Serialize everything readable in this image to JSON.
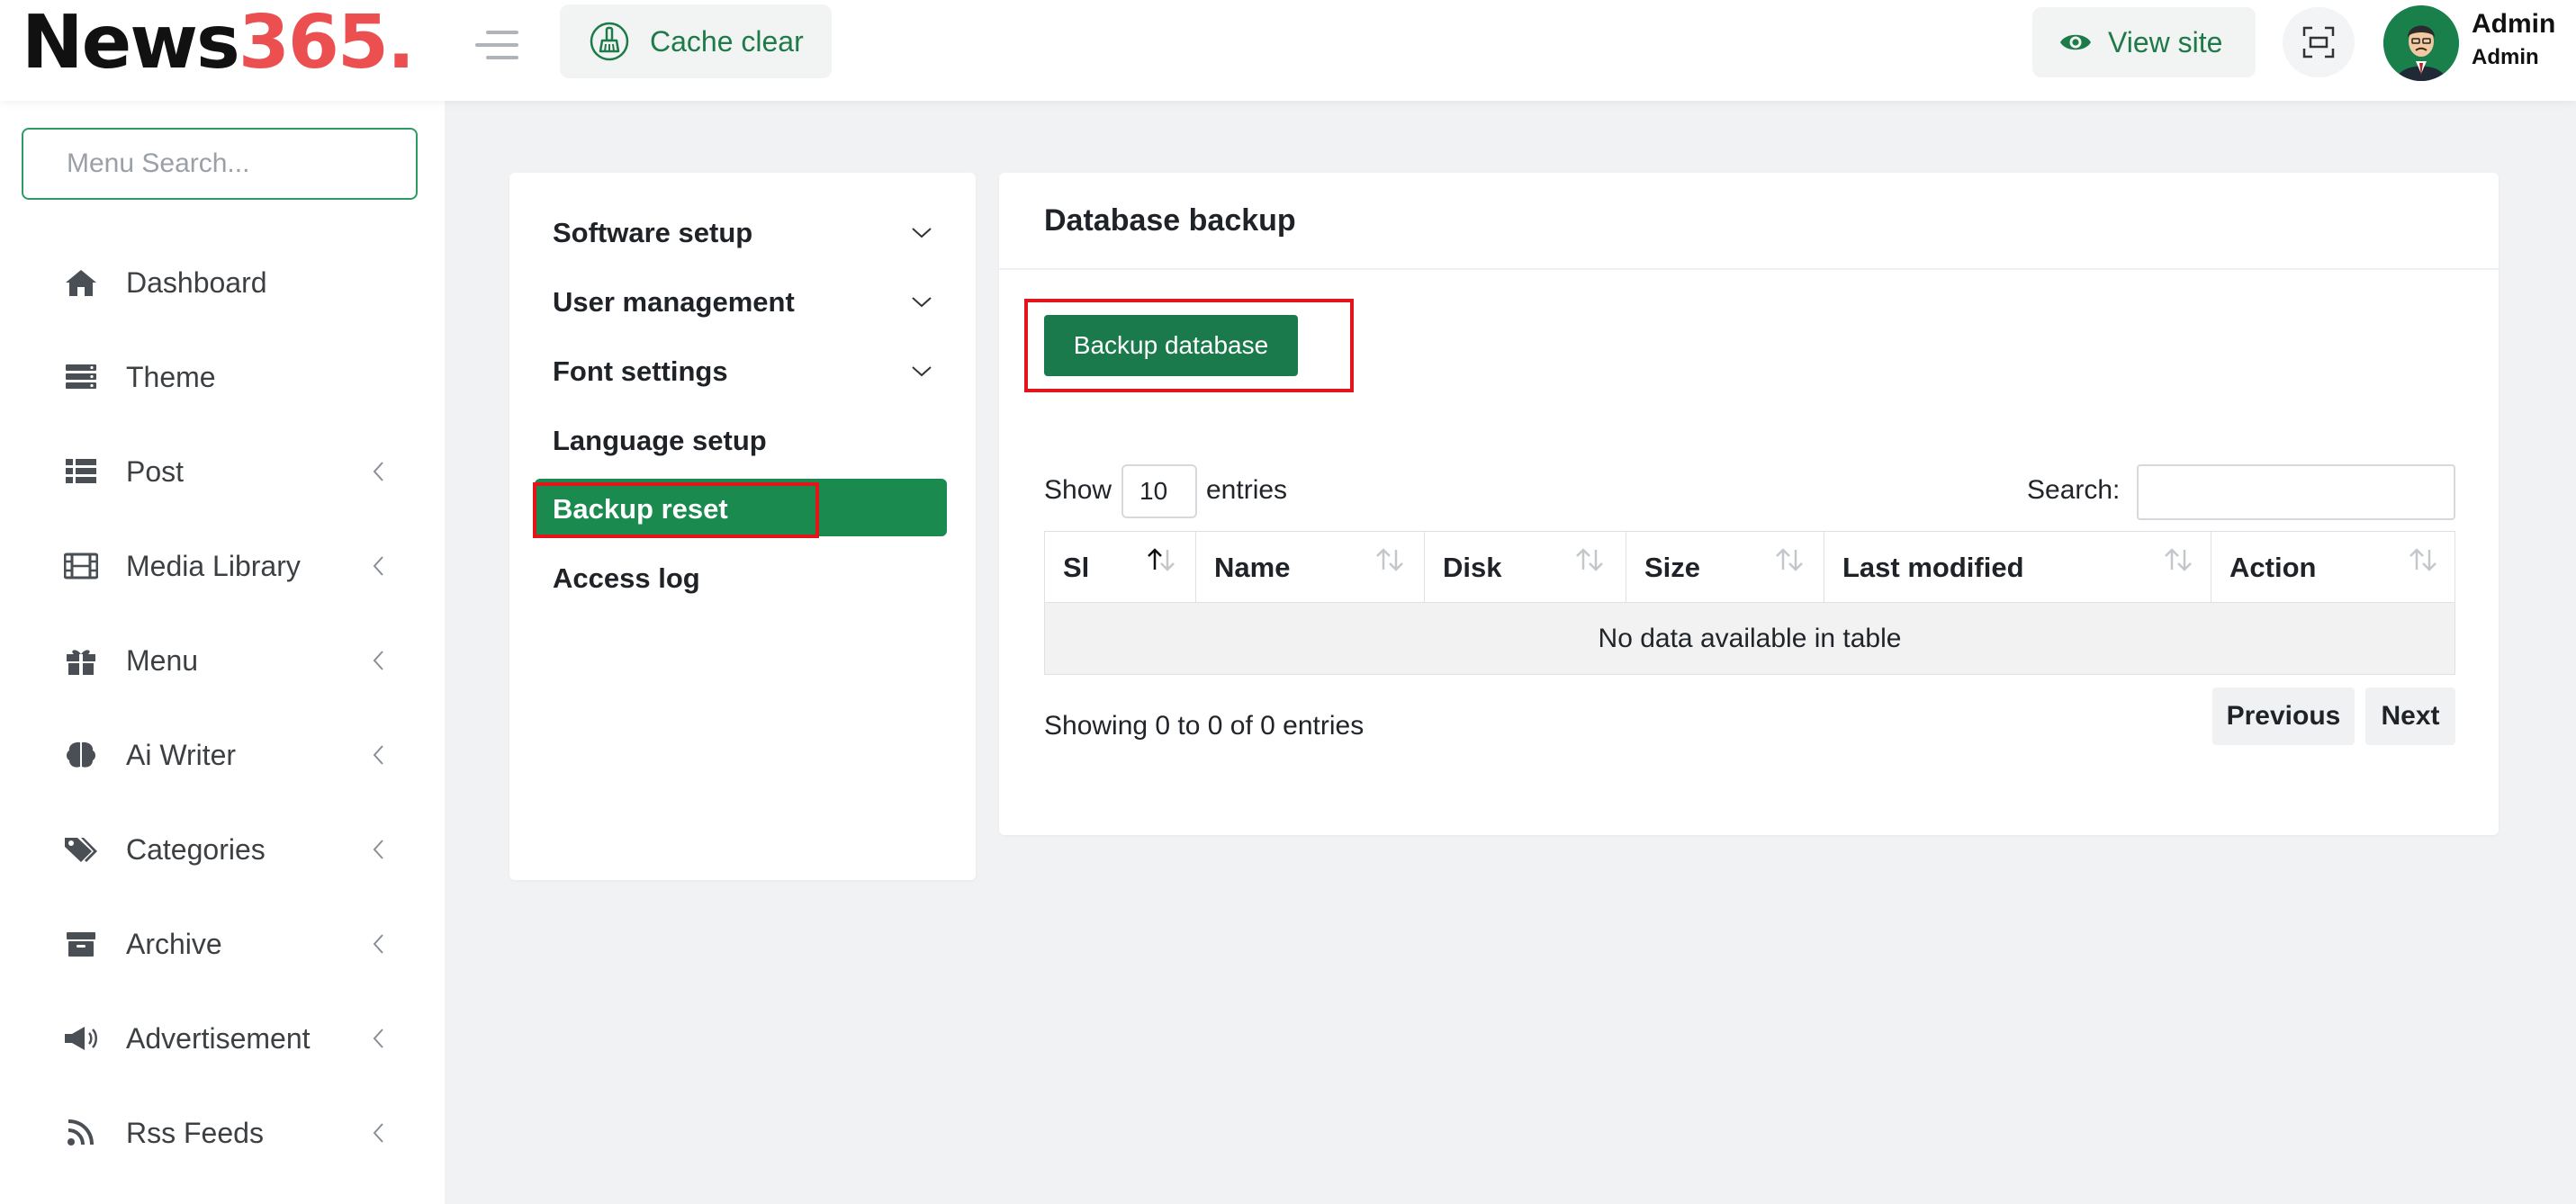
{
  "header": {
    "logo_part1": "News",
    "logo_part2": "365.",
    "cache_clear_label": "Cache clear",
    "view_site_label": "View site",
    "user_name": "Admin",
    "user_role": "Admin"
  },
  "sidebar": {
    "search_placeholder": "Menu Search...",
    "items": [
      {
        "label": "Dashboard",
        "icon": "home-icon",
        "has_chevron": false
      },
      {
        "label": "Theme",
        "icon": "layers-icon",
        "has_chevron": false
      },
      {
        "label": "Post",
        "icon": "list-icon",
        "has_chevron": true
      },
      {
        "label": "Media Library",
        "icon": "film-icon",
        "has_chevron": true
      },
      {
        "label": "Menu",
        "icon": "gift-icon",
        "has_chevron": true
      },
      {
        "label": "Ai Writer",
        "icon": "brain-icon",
        "has_chevron": true
      },
      {
        "label": "Categories",
        "icon": "tags-icon",
        "has_chevron": true
      },
      {
        "label": "Archive",
        "icon": "archive-icon",
        "has_chevron": true
      },
      {
        "label": "Advertisement",
        "icon": "bullhorn-icon",
        "has_chevron": true
      },
      {
        "label": "Rss Feeds",
        "icon": "rss-icon",
        "has_chevron": true
      }
    ]
  },
  "settings": {
    "items": [
      {
        "label": "Software setup",
        "has_chevron": true,
        "active": false
      },
      {
        "label": "User management",
        "has_chevron": true,
        "active": false
      },
      {
        "label": "Font settings",
        "has_chevron": true,
        "active": false
      },
      {
        "label": "Language setup",
        "has_chevron": false,
        "active": false
      },
      {
        "label": "Backup reset",
        "has_chevron": false,
        "active": true
      },
      {
        "label": "Access log",
        "has_chevron": false,
        "active": false
      }
    ]
  },
  "main": {
    "title": "Database backup",
    "backup_button_label": "Backup database",
    "table": {
      "show_label": "Show",
      "entries_value": "10",
      "entries_label": "entries",
      "search_label": "Search:",
      "columns": [
        "Sl",
        "Name",
        "Disk",
        "Size",
        "Last modified",
        "Action"
      ],
      "empty_message": "No data available in table",
      "info": "Showing 0 to 0 of 0 entries",
      "previous_label": "Previous",
      "next_label": "Next"
    }
  },
  "colors": {
    "accent_green": "#1a8a4f",
    "button_green": "#1a7a4b",
    "logo_red": "#ec4f4f",
    "highlight_red": "#e4141b"
  }
}
